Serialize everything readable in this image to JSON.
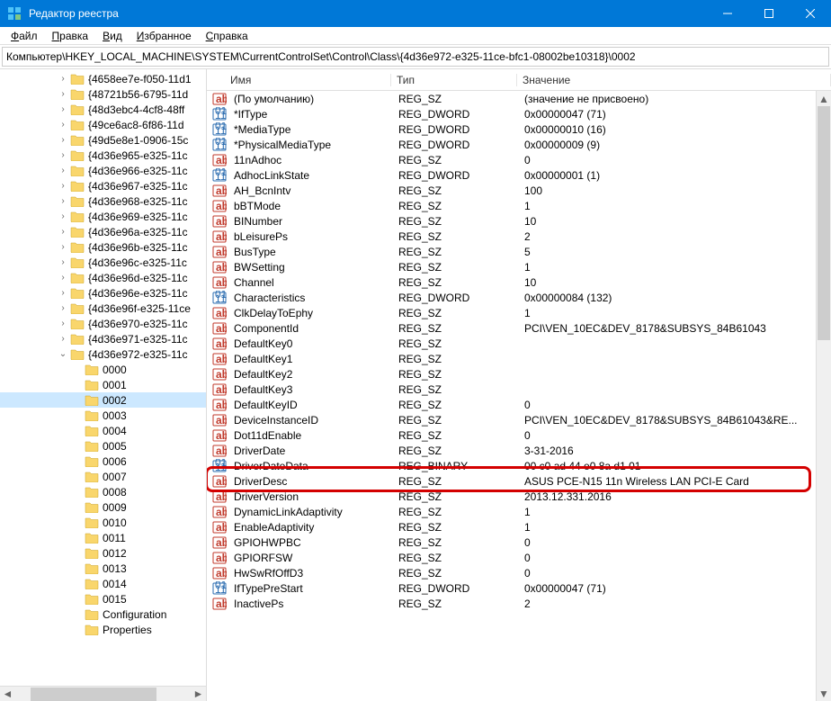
{
  "window": {
    "title": "Редактор реестра"
  },
  "menu": {
    "file": "Файл",
    "edit": "Правка",
    "view": "Вид",
    "favorites": "Избранное",
    "help": "Справка"
  },
  "address": "Компьютер\\HKEY_LOCAL_MACHINE\\SYSTEM\\CurrentControlSet\\Control\\Class\\{4d36e972-e325-11ce-bfc1-08002be10318}\\0002",
  "tree": {
    "items": [
      {
        "indent": 4,
        "exp": ">",
        "label": "{4658ee7e-f050-11d1"
      },
      {
        "indent": 4,
        "exp": ">",
        "label": "{48721b56-6795-11d"
      },
      {
        "indent": 4,
        "exp": ">",
        "label": "{48d3ebc4-4cf8-48ff"
      },
      {
        "indent": 4,
        "exp": ">",
        "label": "{49ce6ac8-6f86-11d"
      },
      {
        "indent": 4,
        "exp": ">",
        "label": "{49d5e8e1-0906-15c"
      },
      {
        "indent": 4,
        "exp": ">",
        "label": "{4d36e965-e325-11c"
      },
      {
        "indent": 4,
        "exp": ">",
        "label": "{4d36e966-e325-11c"
      },
      {
        "indent": 4,
        "exp": ">",
        "label": "{4d36e967-e325-11c"
      },
      {
        "indent": 4,
        "exp": ">",
        "label": "{4d36e968-e325-11c"
      },
      {
        "indent": 4,
        "exp": ">",
        "label": "{4d36e969-e325-11c"
      },
      {
        "indent": 4,
        "exp": ">",
        "label": "{4d36e96a-e325-11c"
      },
      {
        "indent": 4,
        "exp": ">",
        "label": "{4d36e96b-e325-11c"
      },
      {
        "indent": 4,
        "exp": ">",
        "label": "{4d36e96c-e325-11c"
      },
      {
        "indent": 4,
        "exp": ">",
        "label": "{4d36e96d-e325-11c"
      },
      {
        "indent": 4,
        "exp": ">",
        "label": "{4d36e96e-e325-11c"
      },
      {
        "indent": 4,
        "exp": ">",
        "label": "{4d36e96f-e325-11ce"
      },
      {
        "indent": 4,
        "exp": ">",
        "label": "{4d36e970-e325-11c"
      },
      {
        "indent": 4,
        "exp": ">",
        "label": "{4d36e971-e325-11c"
      },
      {
        "indent": 4,
        "exp": "v",
        "label": "{4d36e972-e325-11c"
      },
      {
        "indent": 5,
        "exp": "",
        "label": "0000"
      },
      {
        "indent": 5,
        "exp": "",
        "label": "0001"
      },
      {
        "indent": 5,
        "exp": "",
        "label": "0002",
        "selected": true
      },
      {
        "indent": 5,
        "exp": "",
        "label": "0003"
      },
      {
        "indent": 5,
        "exp": "",
        "label": "0004"
      },
      {
        "indent": 5,
        "exp": "",
        "label": "0005"
      },
      {
        "indent": 5,
        "exp": "",
        "label": "0006"
      },
      {
        "indent": 5,
        "exp": "",
        "label": "0007"
      },
      {
        "indent": 5,
        "exp": "",
        "label": "0008"
      },
      {
        "indent": 5,
        "exp": "",
        "label": "0009"
      },
      {
        "indent": 5,
        "exp": "",
        "label": "0010"
      },
      {
        "indent": 5,
        "exp": "",
        "label": "0011"
      },
      {
        "indent": 5,
        "exp": "",
        "label": "0012"
      },
      {
        "indent": 5,
        "exp": "",
        "label": "0013"
      },
      {
        "indent": 5,
        "exp": "",
        "label": "0014"
      },
      {
        "indent": 5,
        "exp": "",
        "label": "0015"
      },
      {
        "indent": 5,
        "exp": "",
        "label": "Configuration"
      },
      {
        "indent": 5,
        "exp": "",
        "label": "Properties"
      }
    ]
  },
  "columns": {
    "name": "Имя",
    "type": "Тип",
    "value": "Значение"
  },
  "rows": [
    {
      "icon": "sz",
      "name": "(По умолчанию)",
      "type": "REG_SZ",
      "value": "(значение не присвоено)"
    },
    {
      "icon": "bin",
      "name": "*IfType",
      "type": "REG_DWORD",
      "value": "0x00000047 (71)"
    },
    {
      "icon": "bin",
      "name": "*MediaType",
      "type": "REG_DWORD",
      "value": "0x00000010 (16)"
    },
    {
      "icon": "bin",
      "name": "*PhysicalMediaType",
      "type": "REG_DWORD",
      "value": "0x00000009 (9)"
    },
    {
      "icon": "sz",
      "name": "11nAdhoc",
      "type": "REG_SZ",
      "value": "0"
    },
    {
      "icon": "bin",
      "name": "AdhocLinkState",
      "type": "REG_DWORD",
      "value": "0x00000001 (1)"
    },
    {
      "icon": "sz",
      "name": "AH_BcnIntv",
      "type": "REG_SZ",
      "value": "100"
    },
    {
      "icon": "sz",
      "name": "bBTMode",
      "type": "REG_SZ",
      "value": "1"
    },
    {
      "icon": "sz",
      "name": "BINumber",
      "type": "REG_SZ",
      "value": "10"
    },
    {
      "icon": "sz",
      "name": "bLeisurePs",
      "type": "REG_SZ",
      "value": "2"
    },
    {
      "icon": "sz",
      "name": "BusType",
      "type": "REG_SZ",
      "value": "5"
    },
    {
      "icon": "sz",
      "name": "BWSetting",
      "type": "REG_SZ",
      "value": "1"
    },
    {
      "icon": "sz",
      "name": "Channel",
      "type": "REG_SZ",
      "value": "10"
    },
    {
      "icon": "bin",
      "name": "Characteristics",
      "type": "REG_DWORD",
      "value": "0x00000084 (132)"
    },
    {
      "icon": "sz",
      "name": "ClkDelayToEphy",
      "type": "REG_SZ",
      "value": "1"
    },
    {
      "icon": "sz",
      "name": "ComponentId",
      "type": "REG_SZ",
      "value": "PCI\\VEN_10EC&DEV_8178&SUBSYS_84B61043"
    },
    {
      "icon": "sz",
      "name": "DefaultKey0",
      "type": "REG_SZ",
      "value": ""
    },
    {
      "icon": "sz",
      "name": "DefaultKey1",
      "type": "REG_SZ",
      "value": ""
    },
    {
      "icon": "sz",
      "name": "DefaultKey2",
      "type": "REG_SZ",
      "value": ""
    },
    {
      "icon": "sz",
      "name": "DefaultKey3",
      "type": "REG_SZ",
      "value": ""
    },
    {
      "icon": "sz",
      "name": "DefaultKeyID",
      "type": "REG_SZ",
      "value": "0"
    },
    {
      "icon": "sz",
      "name": "DeviceInstanceID",
      "type": "REG_SZ",
      "value": "PCI\\VEN_10EC&DEV_8178&SUBSYS_84B61043&RE..."
    },
    {
      "icon": "sz",
      "name": "Dot11dEnable",
      "type": "REG_SZ",
      "value": "0"
    },
    {
      "icon": "sz",
      "name": "DriverDate",
      "type": "REG_SZ",
      "value": "3-31-2016"
    },
    {
      "icon": "bin",
      "name": "DriverDateData",
      "type": "REG_BINARY",
      "value": "00 c0 ad 44 e0 8a d1 01"
    },
    {
      "icon": "sz",
      "name": "DriverDesc",
      "type": "REG_SZ",
      "value": "ASUS PCE-N15 11n Wireless LAN PCI-E Card",
      "highlighted": true
    },
    {
      "icon": "sz",
      "name": "DriverVersion",
      "type": "REG_SZ",
      "value": "2013.12.331.2016"
    },
    {
      "icon": "sz",
      "name": "DynamicLinkAdaptivity",
      "type": "REG_SZ",
      "value": "1"
    },
    {
      "icon": "sz",
      "name": "EnableAdaptivity",
      "type": "REG_SZ",
      "value": "1"
    },
    {
      "icon": "sz",
      "name": "GPIOHWPBC",
      "type": "REG_SZ",
      "value": "0"
    },
    {
      "icon": "sz",
      "name": "GPIORFSW",
      "type": "REG_SZ",
      "value": "0"
    },
    {
      "icon": "sz",
      "name": "HwSwRfOffD3",
      "type": "REG_SZ",
      "value": "0"
    },
    {
      "icon": "bin",
      "name": "IfTypePreStart",
      "type": "REG_DWORD",
      "value": "0x00000047 (71)"
    },
    {
      "icon": "sz",
      "name": "InactivePs",
      "type": "REG_SZ",
      "value": "2"
    }
  ]
}
